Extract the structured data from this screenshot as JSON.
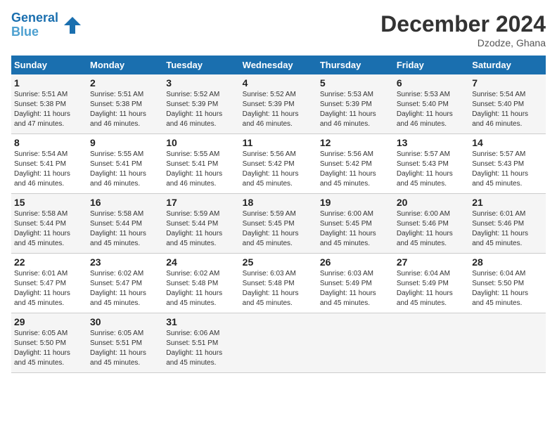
{
  "logo": {
    "line1": "General",
    "line2": "Blue"
  },
  "title": "December 2024",
  "location": "Dzodze, Ghana",
  "days_of_week": [
    "Sunday",
    "Monday",
    "Tuesday",
    "Wednesday",
    "Thursday",
    "Friday",
    "Saturday"
  ],
  "weeks": [
    [
      {
        "day": "1",
        "info": "Sunrise: 5:51 AM\nSunset: 5:38 PM\nDaylight: 11 hours\nand 47 minutes."
      },
      {
        "day": "2",
        "info": "Sunrise: 5:51 AM\nSunset: 5:38 PM\nDaylight: 11 hours\nand 46 minutes."
      },
      {
        "day": "3",
        "info": "Sunrise: 5:52 AM\nSunset: 5:39 PM\nDaylight: 11 hours\nand 46 minutes."
      },
      {
        "day": "4",
        "info": "Sunrise: 5:52 AM\nSunset: 5:39 PM\nDaylight: 11 hours\nand 46 minutes."
      },
      {
        "day": "5",
        "info": "Sunrise: 5:53 AM\nSunset: 5:39 PM\nDaylight: 11 hours\nand 46 minutes."
      },
      {
        "day": "6",
        "info": "Sunrise: 5:53 AM\nSunset: 5:40 PM\nDaylight: 11 hours\nand 46 minutes."
      },
      {
        "day": "7",
        "info": "Sunrise: 5:54 AM\nSunset: 5:40 PM\nDaylight: 11 hours\nand 46 minutes."
      }
    ],
    [
      {
        "day": "8",
        "info": "Sunrise: 5:54 AM\nSunset: 5:41 PM\nDaylight: 11 hours\nand 46 minutes."
      },
      {
        "day": "9",
        "info": "Sunrise: 5:55 AM\nSunset: 5:41 PM\nDaylight: 11 hours\nand 46 minutes."
      },
      {
        "day": "10",
        "info": "Sunrise: 5:55 AM\nSunset: 5:41 PM\nDaylight: 11 hours\nand 46 minutes."
      },
      {
        "day": "11",
        "info": "Sunrise: 5:56 AM\nSunset: 5:42 PM\nDaylight: 11 hours\nand 45 minutes."
      },
      {
        "day": "12",
        "info": "Sunrise: 5:56 AM\nSunset: 5:42 PM\nDaylight: 11 hours\nand 45 minutes."
      },
      {
        "day": "13",
        "info": "Sunrise: 5:57 AM\nSunset: 5:43 PM\nDaylight: 11 hours\nand 45 minutes."
      },
      {
        "day": "14",
        "info": "Sunrise: 5:57 AM\nSunset: 5:43 PM\nDaylight: 11 hours\nand 45 minutes."
      }
    ],
    [
      {
        "day": "15",
        "info": "Sunrise: 5:58 AM\nSunset: 5:44 PM\nDaylight: 11 hours\nand 45 minutes."
      },
      {
        "day": "16",
        "info": "Sunrise: 5:58 AM\nSunset: 5:44 PM\nDaylight: 11 hours\nand 45 minutes."
      },
      {
        "day": "17",
        "info": "Sunrise: 5:59 AM\nSunset: 5:44 PM\nDaylight: 11 hours\nand 45 minutes."
      },
      {
        "day": "18",
        "info": "Sunrise: 5:59 AM\nSunset: 5:45 PM\nDaylight: 11 hours\nand 45 minutes."
      },
      {
        "day": "19",
        "info": "Sunrise: 6:00 AM\nSunset: 5:45 PM\nDaylight: 11 hours\nand 45 minutes."
      },
      {
        "day": "20",
        "info": "Sunrise: 6:00 AM\nSunset: 5:46 PM\nDaylight: 11 hours\nand 45 minutes."
      },
      {
        "day": "21",
        "info": "Sunrise: 6:01 AM\nSunset: 5:46 PM\nDaylight: 11 hours\nand 45 minutes."
      }
    ],
    [
      {
        "day": "22",
        "info": "Sunrise: 6:01 AM\nSunset: 5:47 PM\nDaylight: 11 hours\nand 45 minutes."
      },
      {
        "day": "23",
        "info": "Sunrise: 6:02 AM\nSunset: 5:47 PM\nDaylight: 11 hours\nand 45 minutes."
      },
      {
        "day": "24",
        "info": "Sunrise: 6:02 AM\nSunset: 5:48 PM\nDaylight: 11 hours\nand 45 minutes."
      },
      {
        "day": "25",
        "info": "Sunrise: 6:03 AM\nSunset: 5:48 PM\nDaylight: 11 hours\nand 45 minutes."
      },
      {
        "day": "26",
        "info": "Sunrise: 6:03 AM\nSunset: 5:49 PM\nDaylight: 11 hours\nand 45 minutes."
      },
      {
        "day": "27",
        "info": "Sunrise: 6:04 AM\nSunset: 5:49 PM\nDaylight: 11 hours\nand 45 minutes."
      },
      {
        "day": "28",
        "info": "Sunrise: 6:04 AM\nSunset: 5:50 PM\nDaylight: 11 hours\nand 45 minutes."
      }
    ],
    [
      {
        "day": "29",
        "info": "Sunrise: 6:05 AM\nSunset: 5:50 PM\nDaylight: 11 hours\nand 45 minutes."
      },
      {
        "day": "30",
        "info": "Sunrise: 6:05 AM\nSunset: 5:51 PM\nDaylight: 11 hours\nand 45 minutes."
      },
      {
        "day": "31",
        "info": "Sunrise: 6:06 AM\nSunset: 5:51 PM\nDaylight: 11 hours\nand 45 minutes."
      },
      {
        "day": "",
        "info": ""
      },
      {
        "day": "",
        "info": ""
      },
      {
        "day": "",
        "info": ""
      },
      {
        "day": "",
        "info": ""
      }
    ]
  ]
}
